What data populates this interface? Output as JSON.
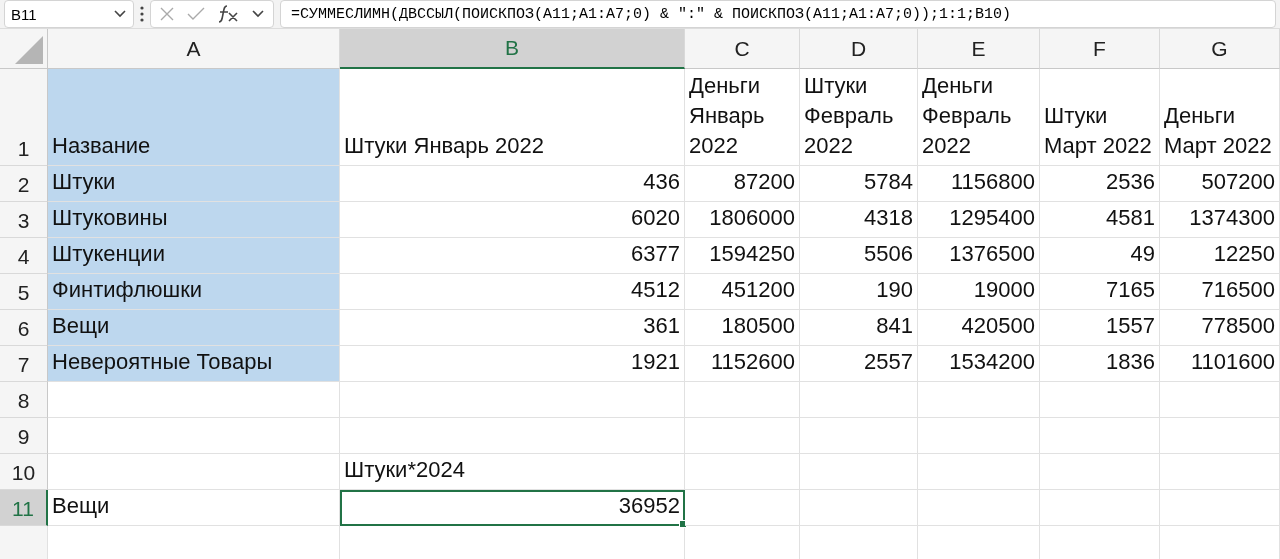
{
  "name_box": "B11",
  "formula": "=СУММЕСЛИМН(ДВССЫЛ(ПОИСКПОЗ(A11;A1:A7;0) & \":\" & ПОИСКПОЗ(A11;A1:A7;0));1:1;B10)",
  "columns": [
    {
      "letter": "A",
      "selected": false
    },
    {
      "letter": "B",
      "selected": true
    },
    {
      "letter": "C",
      "selected": false
    },
    {
      "letter": "D",
      "selected": false
    },
    {
      "letter": "E",
      "selected": false
    },
    {
      "letter": "F",
      "selected": false
    },
    {
      "letter": "G",
      "selected": false
    }
  ],
  "rows": [
    {
      "number": "1",
      "selected": false,
      "cells": [
        {
          "text": "Название",
          "kind": "text",
          "highlighted": true,
          "selected": false
        },
        {
          "text": "Штуки Январь 2022",
          "kind": "text",
          "highlighted": false,
          "selected": false
        },
        {
          "text": "Деньги Январь 2022",
          "kind": "text",
          "highlighted": false,
          "selected": false
        },
        {
          "text": "Штуки Февраль 2022",
          "kind": "text",
          "highlighted": false,
          "selected": false
        },
        {
          "text": "Деньги Февраль 2022",
          "kind": "text",
          "highlighted": false,
          "selected": false
        },
        {
          "text": "Штуки Март 2022",
          "kind": "text",
          "highlighted": false,
          "selected": false
        },
        {
          "text": "Деньги Март 2022",
          "kind": "text",
          "highlighted": false,
          "selected": false
        }
      ]
    },
    {
      "number": "2",
      "selected": false,
      "cells": [
        {
          "text": "Штуки",
          "kind": "text",
          "highlighted": true,
          "selected": false
        },
        {
          "text": "436",
          "kind": "number",
          "highlighted": false,
          "selected": false
        },
        {
          "text": "87200",
          "kind": "number",
          "highlighted": false,
          "selected": false
        },
        {
          "text": "5784",
          "kind": "number",
          "highlighted": false,
          "selected": false
        },
        {
          "text": "1156800",
          "kind": "number",
          "highlighted": false,
          "selected": false
        },
        {
          "text": "2536",
          "kind": "number",
          "highlighted": false,
          "selected": false
        },
        {
          "text": "507200",
          "kind": "number",
          "highlighted": false,
          "selected": false
        }
      ]
    },
    {
      "number": "3",
      "selected": false,
      "cells": [
        {
          "text": "Штуковины",
          "kind": "text",
          "highlighted": true,
          "selected": false
        },
        {
          "text": "6020",
          "kind": "number",
          "highlighted": false,
          "selected": false
        },
        {
          "text": "1806000",
          "kind": "number",
          "highlighted": false,
          "selected": false
        },
        {
          "text": "4318",
          "kind": "number",
          "highlighted": false,
          "selected": false
        },
        {
          "text": "1295400",
          "kind": "number",
          "highlighted": false,
          "selected": false
        },
        {
          "text": "4581",
          "kind": "number",
          "highlighted": false,
          "selected": false
        },
        {
          "text": "1374300",
          "kind": "number",
          "highlighted": false,
          "selected": false
        }
      ]
    },
    {
      "number": "4",
      "selected": false,
      "cells": [
        {
          "text": "Штукенции",
          "kind": "text",
          "highlighted": true,
          "selected": false
        },
        {
          "text": "6377",
          "kind": "number",
          "highlighted": false,
          "selected": false
        },
        {
          "text": "1594250",
          "kind": "number",
          "highlighted": false,
          "selected": false
        },
        {
          "text": "5506",
          "kind": "number",
          "highlighted": false,
          "selected": false
        },
        {
          "text": "1376500",
          "kind": "number",
          "highlighted": false,
          "selected": false
        },
        {
          "text": "49",
          "kind": "number",
          "highlighted": false,
          "selected": false
        },
        {
          "text": "12250",
          "kind": "number",
          "highlighted": false,
          "selected": false
        }
      ]
    },
    {
      "number": "5",
      "selected": false,
      "cells": [
        {
          "text": "Финтифлюшки",
          "kind": "text",
          "highlighted": true,
          "selected": false
        },
        {
          "text": "4512",
          "kind": "number",
          "highlighted": false,
          "selected": false
        },
        {
          "text": "451200",
          "kind": "number",
          "highlighted": false,
          "selected": false
        },
        {
          "text": "190",
          "kind": "number",
          "highlighted": false,
          "selected": false
        },
        {
          "text": "19000",
          "kind": "number",
          "highlighted": false,
          "selected": false
        },
        {
          "text": "7165",
          "kind": "number",
          "highlighted": false,
          "selected": false
        },
        {
          "text": "716500",
          "kind": "number",
          "highlighted": false,
          "selected": false
        }
      ]
    },
    {
      "number": "6",
      "selected": false,
      "cells": [
        {
          "text": "Вещи",
          "kind": "text",
          "highlighted": true,
          "selected": false
        },
        {
          "text": "361",
          "kind": "number",
          "highlighted": false,
          "selected": false
        },
        {
          "text": "180500",
          "kind": "number",
          "highlighted": false,
          "selected": false
        },
        {
          "text": "841",
          "kind": "number",
          "highlighted": false,
          "selected": false
        },
        {
          "text": "420500",
          "kind": "number",
          "highlighted": false,
          "selected": false
        },
        {
          "text": "1557",
          "kind": "number",
          "highlighted": false,
          "selected": false
        },
        {
          "text": "778500",
          "kind": "number",
          "highlighted": false,
          "selected": false
        }
      ]
    },
    {
      "number": "7",
      "selected": false,
      "cells": [
        {
          "text": "Невероятные Товары",
          "kind": "text",
          "highlighted": true,
          "selected": false
        },
        {
          "text": "1921",
          "kind": "number",
          "highlighted": false,
          "selected": false
        },
        {
          "text": "1152600",
          "kind": "number",
          "highlighted": false,
          "selected": false
        },
        {
          "text": "2557",
          "kind": "number",
          "highlighted": false,
          "selected": false
        },
        {
          "text": "1534200",
          "kind": "number",
          "highlighted": false,
          "selected": false
        },
        {
          "text": "1836",
          "kind": "number",
          "highlighted": false,
          "selected": false
        },
        {
          "text": "1101600",
          "kind": "number",
          "highlighted": false,
          "selected": false
        }
      ]
    },
    {
      "number": "8",
      "selected": false,
      "cells": []
    },
    {
      "number": "9",
      "selected": false,
      "cells": []
    },
    {
      "number": "10",
      "selected": false,
      "cells": [
        null,
        {
          "text": "Штуки*2024",
          "kind": "text",
          "highlighted": false,
          "selected": false
        }
      ]
    },
    {
      "number": "11",
      "selected": true,
      "cells": [
        {
          "text": "Вещи",
          "kind": "text",
          "highlighted": false,
          "selected": false
        },
        {
          "text": "36952",
          "kind": "number",
          "highlighted": false,
          "selected": true
        }
      ]
    }
  ]
}
